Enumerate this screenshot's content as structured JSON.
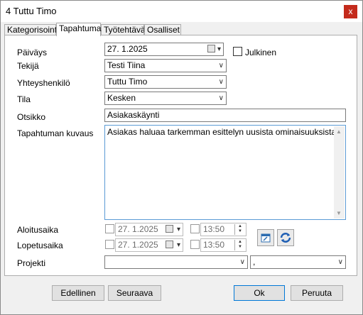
{
  "window": {
    "title": "4 Tuttu Timo",
    "close_glyph": "x"
  },
  "tabs": [
    {
      "label": "Kategorisointi",
      "active": false
    },
    {
      "label": "Tapahtuma",
      "active": true
    },
    {
      "label": "Työtehtävä",
      "active": false
    },
    {
      "label": "Osalliset",
      "active": false
    }
  ],
  "form": {
    "paivays": {
      "label": "Päiväys",
      "value": "27.  1.2025"
    },
    "julkinen": {
      "label": "Julkinen",
      "checked": false
    },
    "tekija": {
      "label": "Tekijä",
      "value": "Testi Tiina"
    },
    "yhteyshenkilo": {
      "label": "Yhteyshenkilö",
      "value": "Tuttu Timo"
    },
    "tila": {
      "label": "Tila",
      "value": "Kesken"
    },
    "otsikko": {
      "label": "Otsikko",
      "value": "Asiakaskäynti"
    },
    "kuvaus": {
      "label": "Tapahtuman kuvaus",
      "value": "Asiakas haluaa tarkemman esittelyn uusista ominaisuuksista."
    },
    "aloitusaika": {
      "label": "Aloitusaika",
      "date": "27.  1.2025",
      "time": "13:50"
    },
    "lopetusaika": {
      "label": "Lopetusaika",
      "date": "27.  1.2025",
      "time": "13:50"
    },
    "projekti": {
      "label": "Projekti",
      "value": "",
      "value2": ","
    }
  },
  "buttons": {
    "previous": "Edellinen",
    "next": "Seuraava",
    "ok": "Ok",
    "cancel": "Peruuta"
  },
  "colors": {
    "accent": "#0078d7",
    "close": "#c42b1c"
  }
}
